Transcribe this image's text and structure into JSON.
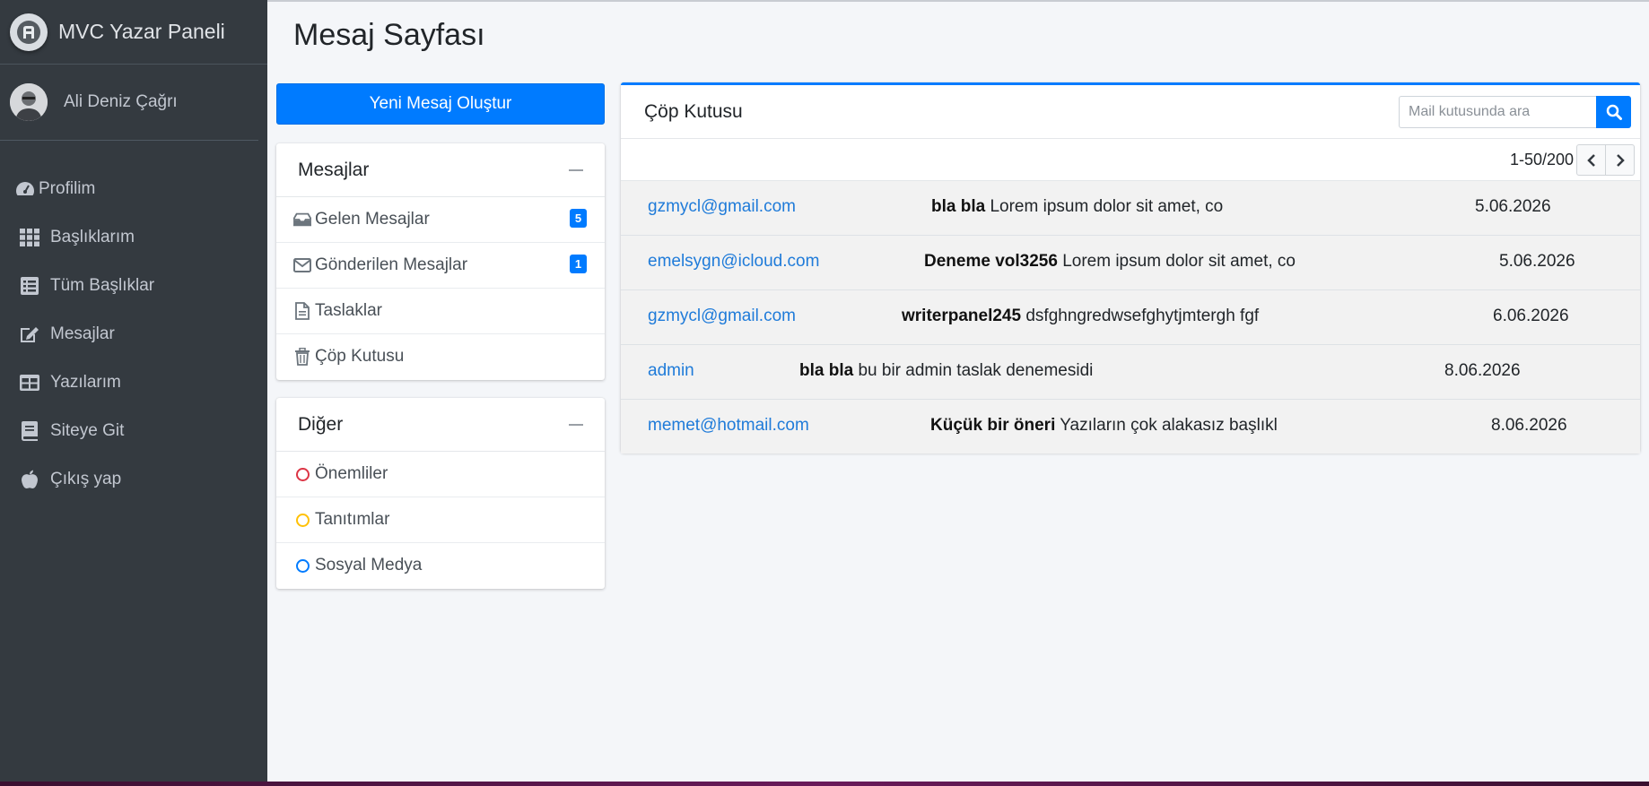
{
  "brand": {
    "title": "MVC Yazar Paneli"
  },
  "user": {
    "name": "Ali Deniz Çağrı"
  },
  "nav": [
    {
      "label": "Profilim",
      "icon": "gauge-icon"
    },
    {
      "label": "Başlıklarım",
      "icon": "grid-icon"
    },
    {
      "label": "Tüm Başlıklar",
      "icon": "list-icon"
    },
    {
      "label": "Mesajlar",
      "icon": "edit-icon"
    },
    {
      "label": "Yazılarım",
      "icon": "table-icon"
    },
    {
      "label": "Siteye Git",
      "icon": "book-icon"
    },
    {
      "label": "Çıkış yap",
      "icon": "apple-icon"
    }
  ],
  "page": {
    "title": "Mesaj Sayfası"
  },
  "compose": {
    "label": "Yeni Mesaj Oluştur"
  },
  "folders": {
    "title": "Mesajlar",
    "items": [
      {
        "label": "Gelen Mesajlar",
        "badge": "5"
      },
      {
        "label": "Gönderilen Mesajlar",
        "badge": "1"
      },
      {
        "label": "Taslaklar"
      },
      {
        "label": "Çöp Kutusu"
      }
    ]
  },
  "labels": {
    "title": "Diğer",
    "items": [
      {
        "label": "Önemliler",
        "color": "#dc3545"
      },
      {
        "label": "Tanıtımlar",
        "color": "#ffc107"
      },
      {
        "label": "Sosyal Medya",
        "color": "#007bff"
      }
    ]
  },
  "mailbox": {
    "title": "Çöp Kutusu",
    "search_placeholder": "Mail kutusunda ara",
    "pager": "1-50/200",
    "rows": [
      {
        "from": "gzmycl@gmail.com",
        "subject": "bla bla",
        "preview": "Lorem ipsum dolor sit amet, co",
        "date": "5.06.2026"
      },
      {
        "from": "emelsygn@icloud.com",
        "subject": "Deneme vol3256",
        "preview": "Lorem ipsum dolor sit amet, co",
        "date": "5.06.2026"
      },
      {
        "from": "gzmycl@gmail.com",
        "subject": "writerpanel245",
        "preview": "dsfghngredwsefghytjmtergh fgf",
        "date": "6.06.2026"
      },
      {
        "from": "admin",
        "subject": "bla bla",
        "preview": "bu bir admin taslak denemesidi",
        "date": "8.06.2026"
      },
      {
        "from": "memet@hotmail.com",
        "subject": "Küçük bir öneri",
        "preview": "Yazıların çok alakasız başlıkl",
        "date": "8.06.2026"
      }
    ]
  },
  "colors": {
    "accent": "#007bff",
    "sidebar": "#343a40",
    "link": "#1f7bd9"
  }
}
